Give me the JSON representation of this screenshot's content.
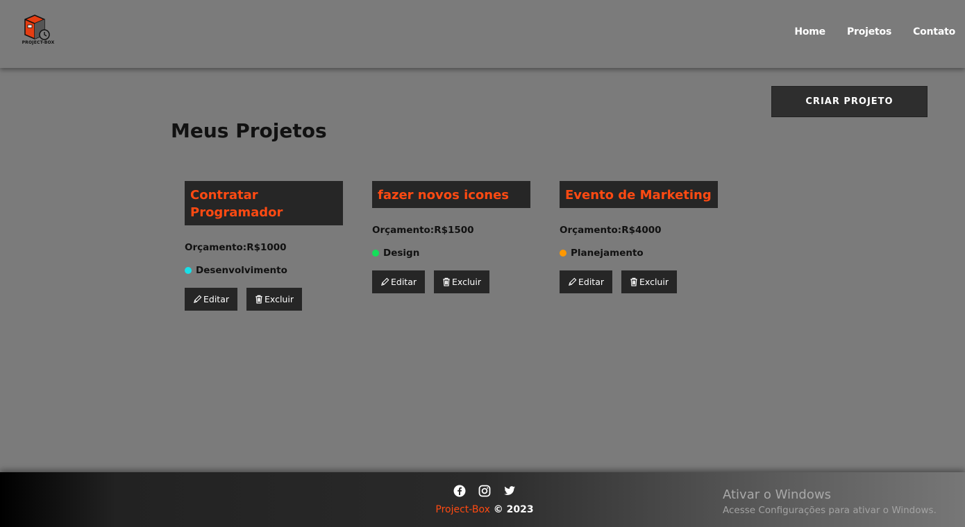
{
  "header": {
    "logo_text": "PROJECT-BOX",
    "nav": [
      "Home",
      "Projetos",
      "Contato"
    ]
  },
  "main": {
    "create_button": "CRIAR PROJETO",
    "title": "Meus Projetos"
  },
  "projects": [
    {
      "title": "Contratar Programador",
      "budget": "Orçamento:R$1000",
      "category": "Desenvolvimento",
      "category_color": "#18e0e8",
      "edit_label": "Editar",
      "delete_label": "Excluir"
    },
    {
      "title": "fazer novos icones",
      "budget": "Orçamento:R$1500",
      "category": "Design",
      "category_color": "#14e05a",
      "edit_label": "Editar",
      "delete_label": "Excluir"
    },
    {
      "title": "Evento de Marketing",
      "budget": "Orçamento:R$4000",
      "category": "Planejamento",
      "category_color": "#ff9800",
      "edit_label": "Editar",
      "delete_label": "Excluir"
    }
  ],
  "footer": {
    "social_icons": [
      "facebook-icon",
      "instagram-icon",
      "twitter-icon"
    ],
    "brand": "Project-Box",
    "year": "© 2023"
  },
  "windows_watermark": {
    "title": "Ativar o Windows",
    "subtitle": "Acesse Configurações para ativar o Windows."
  },
  "colors": {
    "accent": "#ff4a12",
    "background": "#7b7b7b",
    "dark": "#262626"
  }
}
